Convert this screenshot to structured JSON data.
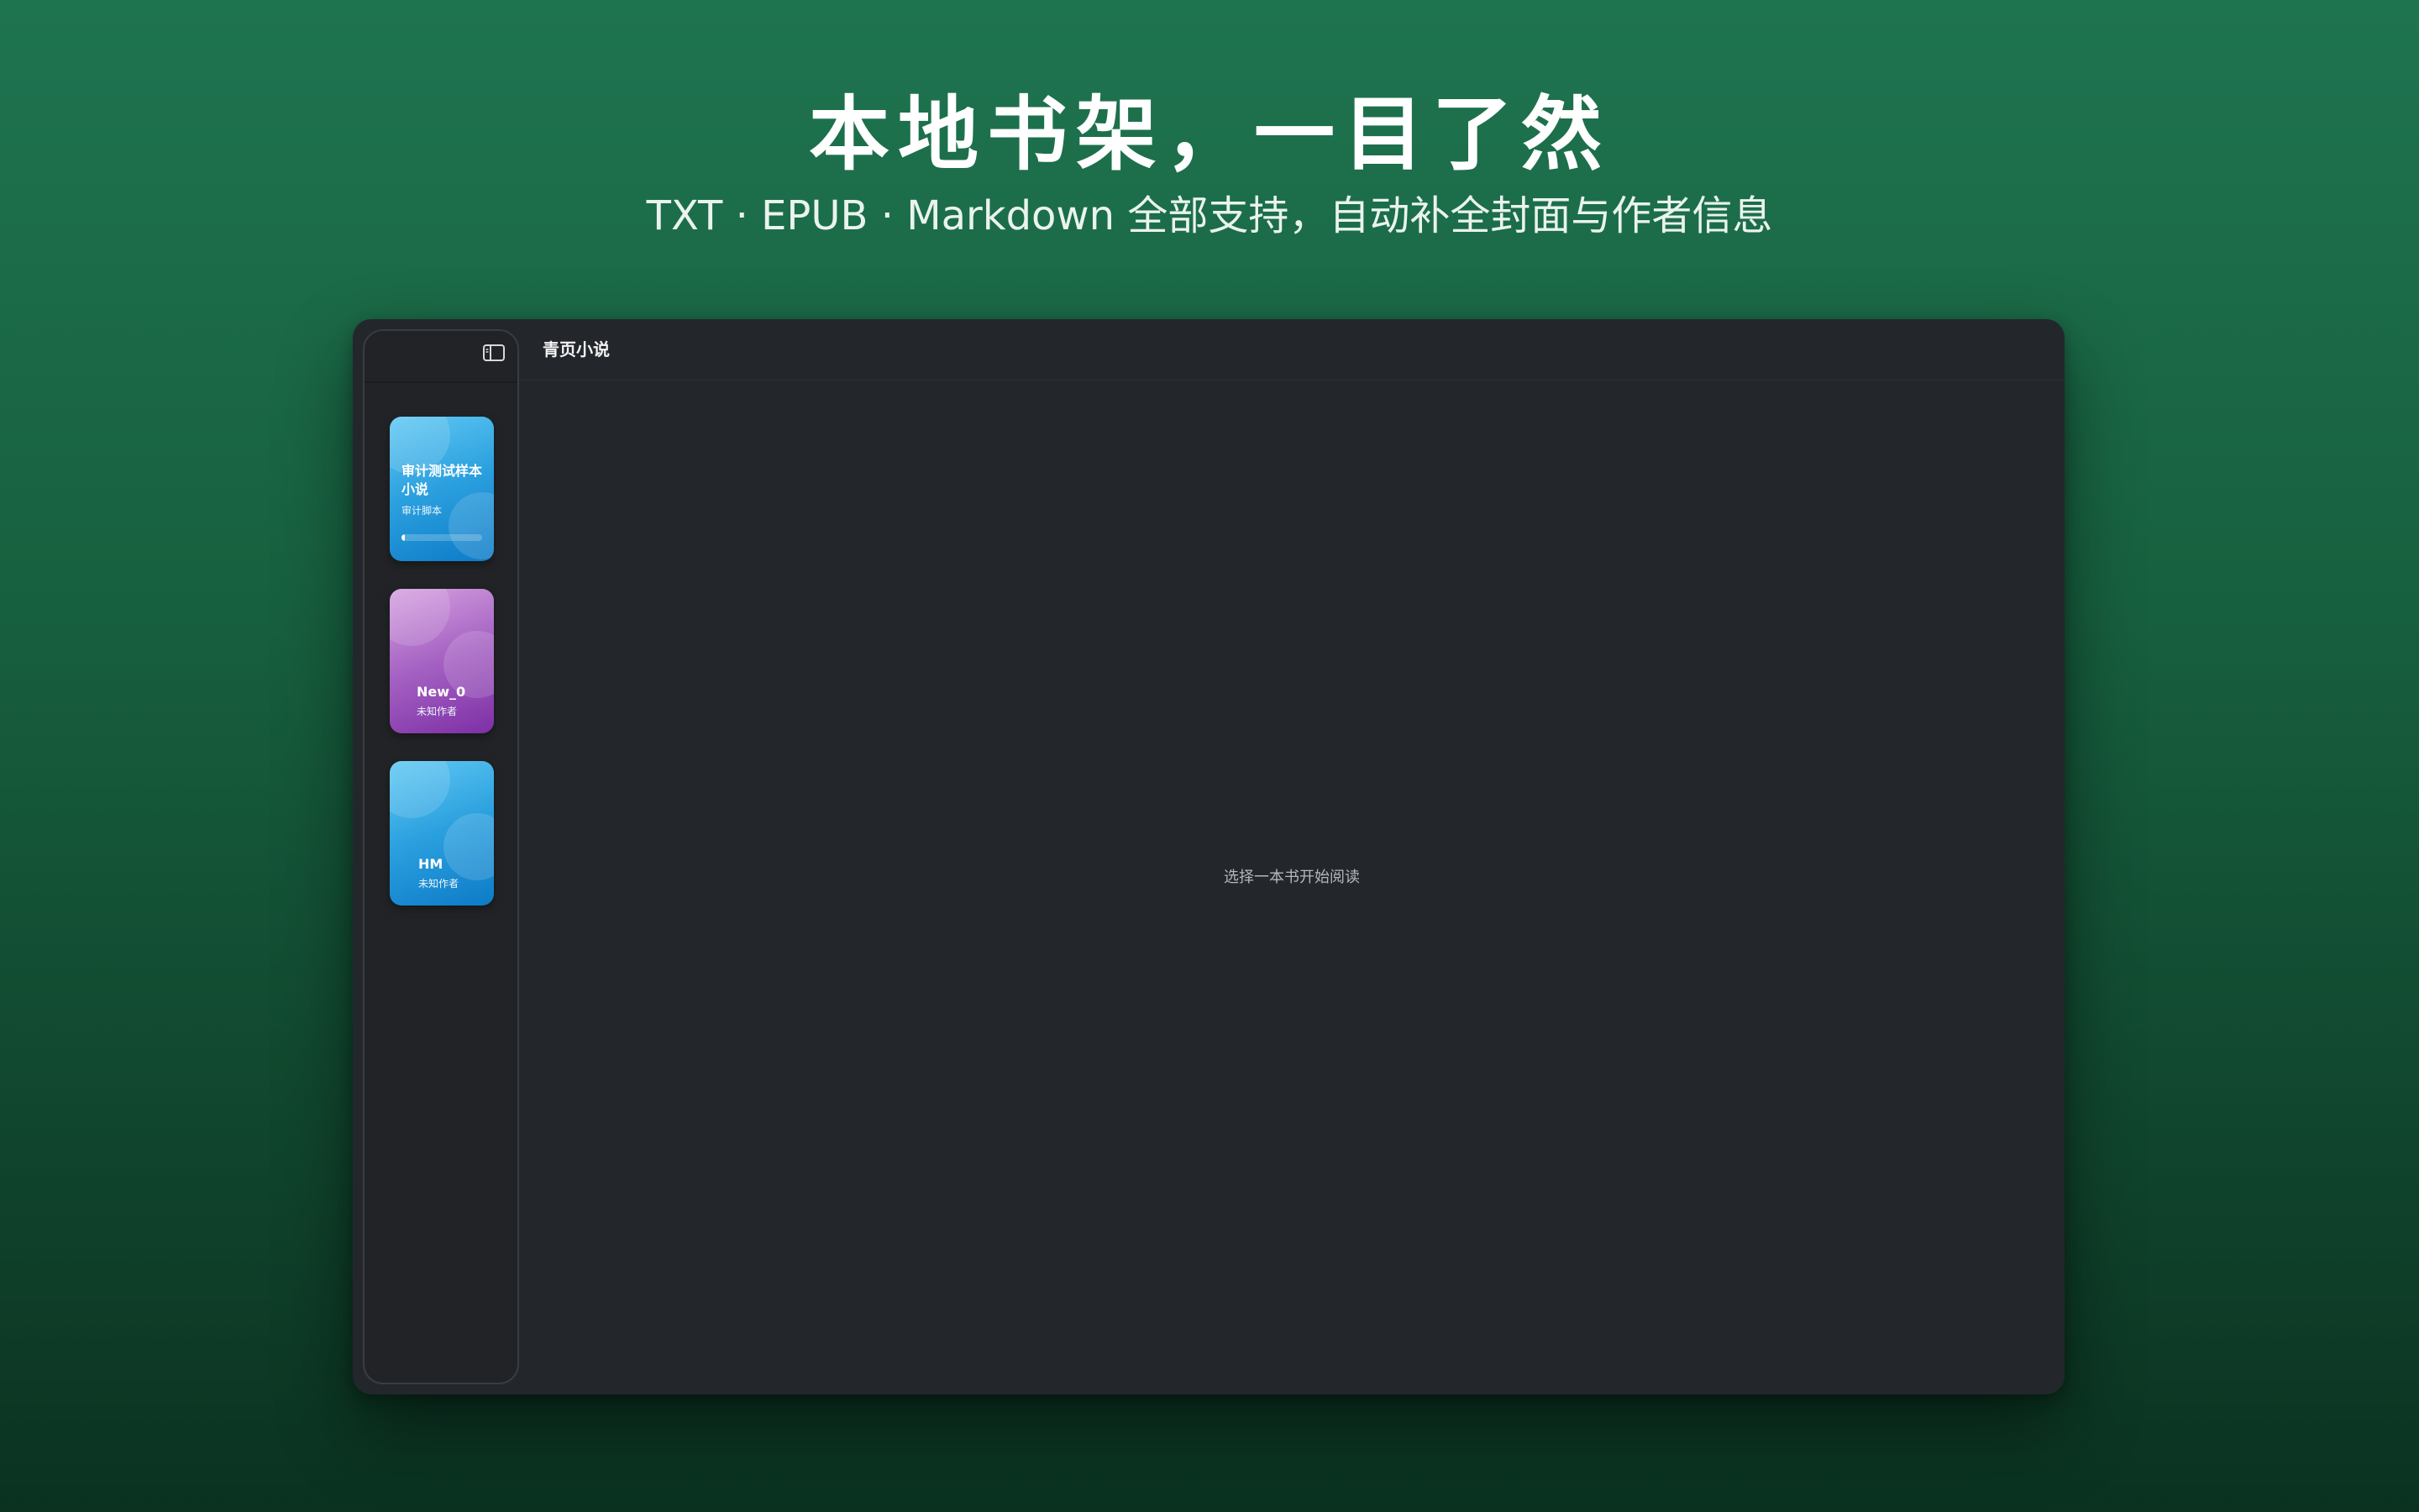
{
  "hero": {
    "title": "本地书架，一目了然",
    "subtitle": "TXT ·   EPUB ·   Markdown 全部支持，自动补全封面与作者信息"
  },
  "window": {
    "app_title": "青页小说",
    "sidebar_toggle_icon": "sidebar-toggle-icon",
    "empty_hint": "选择一本书开始阅读"
  },
  "books": [
    {
      "title": "审计测试样本小说",
      "author": "审计脚本",
      "color": "#2a9fde",
      "progress": 0.04
    },
    {
      "title": "New_0",
      "author": "未知作者",
      "color": "#a461c2"
    },
    {
      "title": "HM",
      "author": "未知作者",
      "color": "#2a9fde"
    }
  ],
  "colors": {
    "background": "#1a6446",
    "window": "#23272c",
    "sidebar": "#212326"
  }
}
